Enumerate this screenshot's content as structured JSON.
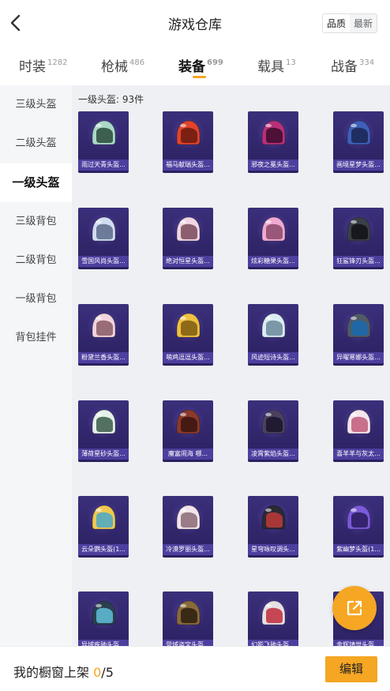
{
  "header": {
    "title": "游戏仓库",
    "toggle": [
      "品质",
      "最新"
    ],
    "toggle_active": 0
  },
  "tabs": [
    {
      "label": "时装",
      "count": "1282"
    },
    {
      "label": "枪械",
      "count": "486"
    },
    {
      "label": "装备",
      "count": "699"
    },
    {
      "label": "载具",
      "count": "13"
    },
    {
      "label": "战备",
      "count": "334"
    }
  ],
  "active_tab": 2,
  "sidebar": {
    "items": [
      "三级头盔",
      "二级头盔",
      "一级头盔",
      "三级背包",
      "二级背包",
      "一级背包",
      "背包挂件"
    ],
    "active": 2
  },
  "section": {
    "label": "一级头盔: 93件"
  },
  "items": [
    {
      "name": "雨过天青头盔...",
      "color": "#a9d8c6",
      "accent": "#2a4a3a"
    },
    {
      "name": "福马献瑞头盔...",
      "color": "#e0442a",
      "accent": "#6a1a10"
    },
    {
      "name": "邪夜之冕头盔...",
      "color": "#b8307a",
      "accent": "#3a0a2a"
    },
    {
      "name": "画境星梦头盔...",
      "color": "#3f5fb8",
      "accent": "#1a2550"
    },
    {
      "name": "雪国风尚头盔...",
      "color": "#d2dcf0",
      "accent": "#5a6a8a"
    },
    {
      "name": "绝对恒星头盔...",
      "color": "#f0d6e2",
      "accent": "#7a4a5a"
    },
    {
      "name": "炫彩糖果头盔...",
      "color": "#f0a8d0",
      "accent": "#8a4a6a"
    },
    {
      "name": "狂鲨锋刃头盔...",
      "color": "#3a3f48",
      "accent": "#101216"
    },
    {
      "name": "粉黛兰香头盔...",
      "color": "#f2d4dc",
      "accent": "#8a5a66"
    },
    {
      "name": "萌鸡逗逗头盔...",
      "color": "#f0c040",
      "accent": "#7a5a10"
    },
    {
      "name": "风迹短诗头盔...",
      "color": "#dcecf4",
      "accent": "#6a8a9a"
    },
    {
      "name": "异曜寒娜头盔...",
      "color": "#505a66",
      "accent": "#1a6ab0"
    },
    {
      "name": "薄荷星砂头盔...",
      "color": "#e4f0e8",
      "accent": "#3a5a48"
    },
    {
      "name": "魔富闹海 哪...",
      "color": "#8a3a2a",
      "accent": "#3a1410"
    },
    {
      "name": "凌霄紫焰头盔...",
      "color": "#4a4060",
      "accent": "#1a1428"
    },
    {
      "name": "喜羊羊与灰太...",
      "color": "#f4e4ec",
      "accent": "#c05a7a"
    },
    {
      "name": "云朵鹦头盔(1...",
      "color": "#f0c850",
      "accent": "#4aa8c8"
    },
    {
      "name": "冷漠罗丽头盔...",
      "color": "#f2e4ea",
      "accent": "#8a6a74"
    },
    {
      "name": "星穹咏叹调头...",
      "color": "#2a2a34",
      "accent": "#c03a3a"
    },
    {
      "name": "紫幽梦头盔(1...",
      "color": "#7a5ad8",
      "accent": "#2a1a5a"
    },
    {
      "name": "异域疾驰头盔...",
      "color": "#2a4050",
      "accent": "#60c0d8"
    },
    {
      "name": "受域盗宝头盔...",
      "color": "#8a6a3a",
      "accent": "#2a1e10"
    },
    {
      "name": "幻影飞驰头盔...",
      "color": "#e6e0e4",
      "accent": "#c02a3a"
    },
    {
      "name": "金辉镇世头盔...",
      "color": "#3a3048",
      "accent": "#d0a030"
    }
  ],
  "bottom": {
    "showcase_label": "我的橱窗上架",
    "current": "0",
    "total": "/5",
    "edit_label": "编辑"
  },
  "colors": {
    "accent": "#f5a623",
    "card_bg": "#2b2060",
    "card_label_bg": "#4d3f9e"
  },
  "icons": {
    "back": "chevron-left-icon",
    "share": "share-external-icon"
  }
}
